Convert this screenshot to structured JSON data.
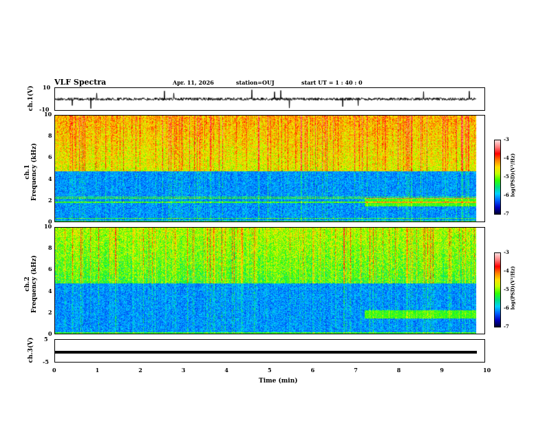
{
  "header": {
    "title": "VLF Spectra",
    "date": "Apr. 11, 2026",
    "station": "station=OUJ",
    "start": "start  UT =   1 : 40 : 0"
  },
  "panels": {
    "ch1": {
      "label": "ch.1(V)",
      "ymax": "10",
      "ymin": "-10"
    },
    "spec1": {
      "label": "ch.1",
      "sublabel": "Frequency  (kHz)"
    },
    "spec2": {
      "label": "ch.2",
      "sublabel": "Frequency  (kHz)"
    },
    "ch3": {
      "label": "ch.3(V)",
      "ymax": "5",
      "ymin": "-5"
    }
  },
  "colorbar": {
    "label": "log(PSD)(V²/Hz)",
    "ticks": [
      "-3",
      "-4",
      "-5",
      "-6",
      "-7"
    ],
    "range": [
      -7,
      -3
    ],
    "colormap": "rainbow"
  },
  "chart_data": {
    "type": "heatmap",
    "xlabel": "Time  (min)",
    "xlim": [
      0,
      10
    ],
    "xticks": [
      "0",
      "1",
      "2",
      "3",
      "4",
      "5",
      "6",
      "7",
      "8",
      "9",
      "10"
    ],
    "ylabel": "Frequency  (kHz)",
    "ylim": [
      0,
      10
    ],
    "yticks": [
      "0",
      "2",
      "4",
      "6",
      "8",
      "10"
    ],
    "data_end_min": 9.8,
    "ch3_level_V": -1
  }
}
